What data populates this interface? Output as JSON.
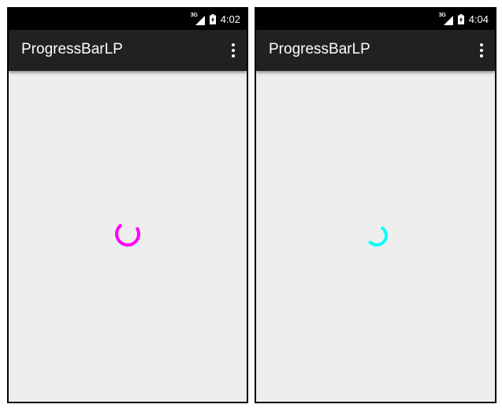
{
  "screens": [
    {
      "status_bar": {
        "network_type": "3G",
        "time": "4:02"
      },
      "action_bar": {
        "title": "ProgressBarLP"
      },
      "progress": {
        "indeterminate": true,
        "color": "#ff00ff",
        "icon": "spinner-arc"
      }
    },
    {
      "status_bar": {
        "network_type": "3G",
        "time": "4:04"
      },
      "action_bar": {
        "title": "ProgressBarLP"
      },
      "progress": {
        "indeterminate": true,
        "color": "#00ffff",
        "icon": "spinner-arc"
      }
    }
  ],
  "icons": {
    "signal": "signal-icon",
    "battery": "battery-icon",
    "overflow": "more-vert-icon"
  }
}
